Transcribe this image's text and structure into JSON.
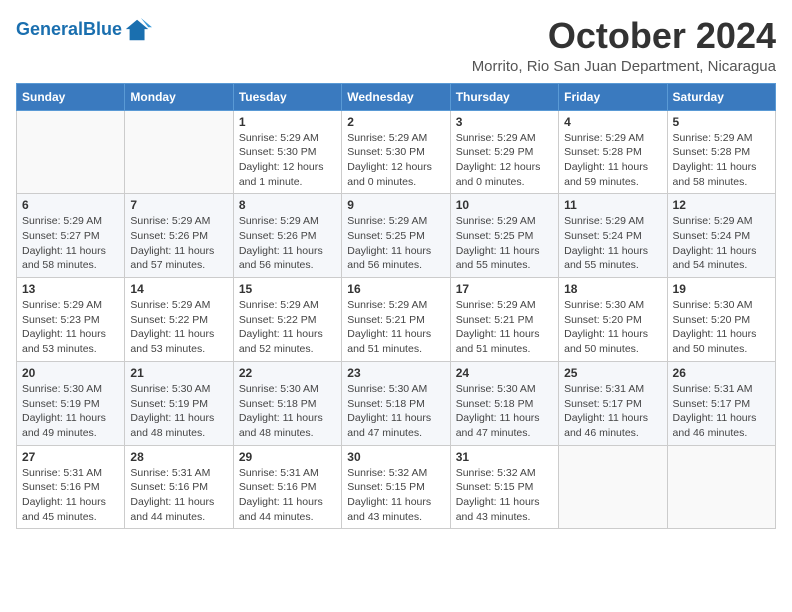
{
  "logo": {
    "text_general": "General",
    "text_blue": "Blue"
  },
  "header": {
    "month": "October 2024",
    "location": "Morrito, Rio San Juan Department, Nicaragua"
  },
  "weekdays": [
    "Sunday",
    "Monday",
    "Tuesday",
    "Wednesday",
    "Thursday",
    "Friday",
    "Saturday"
  ],
  "weeks": [
    [
      {
        "day": "",
        "sunrise": "",
        "sunset": "",
        "daylight": ""
      },
      {
        "day": "",
        "sunrise": "",
        "sunset": "",
        "daylight": ""
      },
      {
        "day": "1",
        "sunrise": "Sunrise: 5:29 AM",
        "sunset": "Sunset: 5:30 PM",
        "daylight": "Daylight: 12 hours and 1 minute."
      },
      {
        "day": "2",
        "sunrise": "Sunrise: 5:29 AM",
        "sunset": "Sunset: 5:30 PM",
        "daylight": "Daylight: 12 hours and 0 minutes."
      },
      {
        "day": "3",
        "sunrise": "Sunrise: 5:29 AM",
        "sunset": "Sunset: 5:29 PM",
        "daylight": "Daylight: 12 hours and 0 minutes."
      },
      {
        "day": "4",
        "sunrise": "Sunrise: 5:29 AM",
        "sunset": "Sunset: 5:28 PM",
        "daylight": "Daylight: 11 hours and 59 minutes."
      },
      {
        "day": "5",
        "sunrise": "Sunrise: 5:29 AM",
        "sunset": "Sunset: 5:28 PM",
        "daylight": "Daylight: 11 hours and 58 minutes."
      }
    ],
    [
      {
        "day": "6",
        "sunrise": "Sunrise: 5:29 AM",
        "sunset": "Sunset: 5:27 PM",
        "daylight": "Daylight: 11 hours and 58 minutes."
      },
      {
        "day": "7",
        "sunrise": "Sunrise: 5:29 AM",
        "sunset": "Sunset: 5:26 PM",
        "daylight": "Daylight: 11 hours and 57 minutes."
      },
      {
        "day": "8",
        "sunrise": "Sunrise: 5:29 AM",
        "sunset": "Sunset: 5:26 PM",
        "daylight": "Daylight: 11 hours and 56 minutes."
      },
      {
        "day": "9",
        "sunrise": "Sunrise: 5:29 AM",
        "sunset": "Sunset: 5:25 PM",
        "daylight": "Daylight: 11 hours and 56 minutes."
      },
      {
        "day": "10",
        "sunrise": "Sunrise: 5:29 AM",
        "sunset": "Sunset: 5:25 PM",
        "daylight": "Daylight: 11 hours and 55 minutes."
      },
      {
        "day": "11",
        "sunrise": "Sunrise: 5:29 AM",
        "sunset": "Sunset: 5:24 PM",
        "daylight": "Daylight: 11 hours and 55 minutes."
      },
      {
        "day": "12",
        "sunrise": "Sunrise: 5:29 AM",
        "sunset": "Sunset: 5:24 PM",
        "daylight": "Daylight: 11 hours and 54 minutes."
      }
    ],
    [
      {
        "day": "13",
        "sunrise": "Sunrise: 5:29 AM",
        "sunset": "Sunset: 5:23 PM",
        "daylight": "Daylight: 11 hours and 53 minutes."
      },
      {
        "day": "14",
        "sunrise": "Sunrise: 5:29 AM",
        "sunset": "Sunset: 5:22 PM",
        "daylight": "Daylight: 11 hours and 53 minutes."
      },
      {
        "day": "15",
        "sunrise": "Sunrise: 5:29 AM",
        "sunset": "Sunset: 5:22 PM",
        "daylight": "Daylight: 11 hours and 52 minutes."
      },
      {
        "day": "16",
        "sunrise": "Sunrise: 5:29 AM",
        "sunset": "Sunset: 5:21 PM",
        "daylight": "Daylight: 11 hours and 51 minutes."
      },
      {
        "day": "17",
        "sunrise": "Sunrise: 5:29 AM",
        "sunset": "Sunset: 5:21 PM",
        "daylight": "Daylight: 11 hours and 51 minutes."
      },
      {
        "day": "18",
        "sunrise": "Sunrise: 5:30 AM",
        "sunset": "Sunset: 5:20 PM",
        "daylight": "Daylight: 11 hours and 50 minutes."
      },
      {
        "day": "19",
        "sunrise": "Sunrise: 5:30 AM",
        "sunset": "Sunset: 5:20 PM",
        "daylight": "Daylight: 11 hours and 50 minutes."
      }
    ],
    [
      {
        "day": "20",
        "sunrise": "Sunrise: 5:30 AM",
        "sunset": "Sunset: 5:19 PM",
        "daylight": "Daylight: 11 hours and 49 minutes."
      },
      {
        "day": "21",
        "sunrise": "Sunrise: 5:30 AM",
        "sunset": "Sunset: 5:19 PM",
        "daylight": "Daylight: 11 hours and 48 minutes."
      },
      {
        "day": "22",
        "sunrise": "Sunrise: 5:30 AM",
        "sunset": "Sunset: 5:18 PM",
        "daylight": "Daylight: 11 hours and 48 minutes."
      },
      {
        "day": "23",
        "sunrise": "Sunrise: 5:30 AM",
        "sunset": "Sunset: 5:18 PM",
        "daylight": "Daylight: 11 hours and 47 minutes."
      },
      {
        "day": "24",
        "sunrise": "Sunrise: 5:30 AM",
        "sunset": "Sunset: 5:18 PM",
        "daylight": "Daylight: 11 hours and 47 minutes."
      },
      {
        "day": "25",
        "sunrise": "Sunrise: 5:31 AM",
        "sunset": "Sunset: 5:17 PM",
        "daylight": "Daylight: 11 hours and 46 minutes."
      },
      {
        "day": "26",
        "sunrise": "Sunrise: 5:31 AM",
        "sunset": "Sunset: 5:17 PM",
        "daylight": "Daylight: 11 hours and 46 minutes."
      }
    ],
    [
      {
        "day": "27",
        "sunrise": "Sunrise: 5:31 AM",
        "sunset": "Sunset: 5:16 PM",
        "daylight": "Daylight: 11 hours and 45 minutes."
      },
      {
        "day": "28",
        "sunrise": "Sunrise: 5:31 AM",
        "sunset": "Sunset: 5:16 PM",
        "daylight": "Daylight: 11 hours and 44 minutes."
      },
      {
        "day": "29",
        "sunrise": "Sunrise: 5:31 AM",
        "sunset": "Sunset: 5:16 PM",
        "daylight": "Daylight: 11 hours and 44 minutes."
      },
      {
        "day": "30",
        "sunrise": "Sunrise: 5:32 AM",
        "sunset": "Sunset: 5:15 PM",
        "daylight": "Daylight: 11 hours and 43 minutes."
      },
      {
        "day": "31",
        "sunrise": "Sunrise: 5:32 AM",
        "sunset": "Sunset: 5:15 PM",
        "daylight": "Daylight: 11 hours and 43 minutes."
      },
      {
        "day": "",
        "sunrise": "",
        "sunset": "",
        "daylight": ""
      },
      {
        "day": "",
        "sunrise": "",
        "sunset": "",
        "daylight": ""
      }
    ]
  ]
}
